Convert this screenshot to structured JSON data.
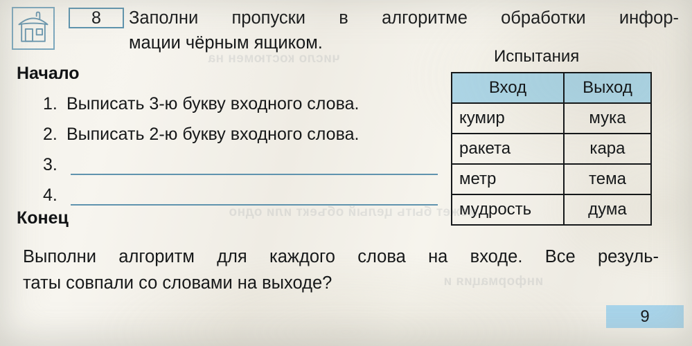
{
  "task": {
    "icon": "house-icon",
    "number": "8",
    "prompt_line1": "Заполни пропуски в алгоритме обработки инфор-",
    "prompt_line2": "мации чёрным ящиком."
  },
  "algorithm": {
    "start_label": "Начало",
    "end_label": "Конец",
    "steps": [
      {
        "num": "1.",
        "text": "Выписать 3-ю букву входного слова.",
        "blank": false
      },
      {
        "num": "2.",
        "text": "Выписать 2-ю букву входного слова.",
        "blank": false
      },
      {
        "num": "3.",
        "text": "",
        "blank": true
      },
      {
        "num": "4.",
        "text": "",
        "blank": true
      }
    ]
  },
  "tests": {
    "title": "Испытания",
    "columns": [
      "Вход",
      "Выход"
    ],
    "rows": [
      {
        "input": "кумир",
        "output": "мука"
      },
      {
        "input": "ракета",
        "output": "кара"
      },
      {
        "input": "метр",
        "output": "тема"
      },
      {
        "input": "мудрость",
        "output": "дума"
      }
    ]
  },
  "closing": {
    "line1": "Выполни алгоритм для каждого слова на входе. Все резуль-",
    "line2": "таты совпали со словами на выходе?"
  },
  "page_number": "9",
  "ghost_text": {
    "g1": "число костюмен на",
    "g2": "может быть целый объект или одно",
    "g3": "информация и"
  },
  "colors": {
    "accent_blue": "#5d93ad",
    "header_fill": "#aed7e8",
    "page_band": "#a8d4ea",
    "paper": "#f3f1ea",
    "ink": "#15181a"
  }
}
